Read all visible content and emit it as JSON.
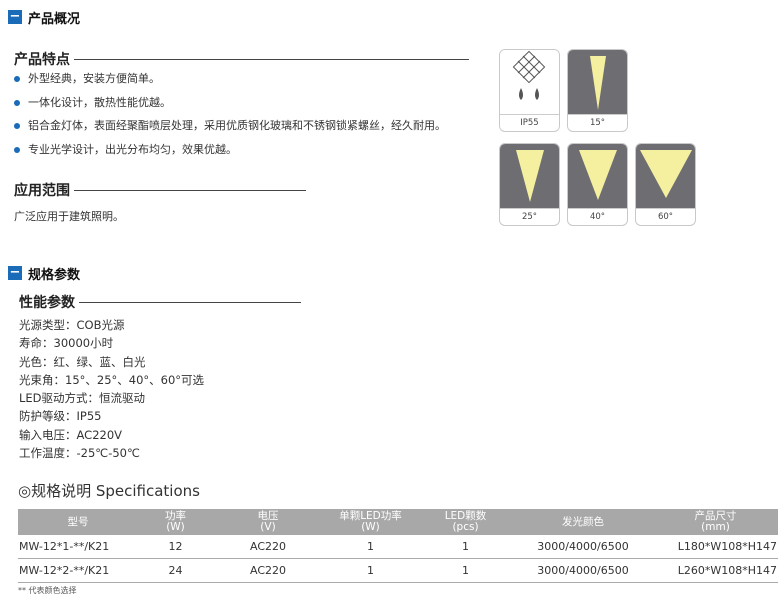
{
  "sections": {
    "overview": "产品概况",
    "specs": "规格参数"
  },
  "features": {
    "title": "产品特点",
    "items": [
      "外型经典，安装方便简单。",
      "一体化设计，散热性能优越。",
      "铝合金灯体，表面经聚酯喷层处理，采用优质钢化玻璃和不锈钢锁紧螺丝，经久耐用。",
      "专业光学设计，出光分布均匀，效果优越。"
    ]
  },
  "application": {
    "title": "应用范围",
    "text": "广泛应用于建筑照明。"
  },
  "cards": {
    "ip": "IP55",
    "beams": [
      "15°",
      "25°",
      "40°",
      "60°"
    ]
  },
  "performance": {
    "title": "性能参数",
    "items": [
      "光源类型：COB光源",
      "寿命：30000小时",
      "光色：红、绿、蓝、白光",
      "光束角：15°、25°、40°、60°可选",
      "LED驱动方式：恒流驱动",
      "防护等级：IP55",
      "输入电压：AC220V",
      "工作温度：-25℃-50℃"
    ]
  },
  "spec_table": {
    "title": "◎规格说明 Specifications",
    "headers": [
      [
        "型号",
        ""
      ],
      [
        "功率",
        "(W)"
      ],
      [
        "电压",
        "(V)"
      ],
      [
        "单颗LED功率",
        "(W)"
      ],
      [
        "LED颗数",
        "(pcs)"
      ],
      [
        "发光颜色",
        ""
      ],
      [
        "产品尺寸",
        "(mm)"
      ]
    ],
    "rows": [
      [
        "MW-12*1-**/K21",
        "12",
        "AC220",
        "1",
        "1",
        "3000/4000/6500",
        "L180*W108*H147"
      ],
      [
        "MW-12*2-**/K21",
        "24",
        "AC220",
        "1",
        "1",
        "3000/4000/6500",
        "L260*W108*H147"
      ]
    ],
    "note": "** 代表颜色选择"
  },
  "colors": {
    "accent": "#1a6bb8",
    "beam": "#f5f0a0",
    "card_bg": "#6e6e72",
    "table_header": "#a8a8a8"
  }
}
